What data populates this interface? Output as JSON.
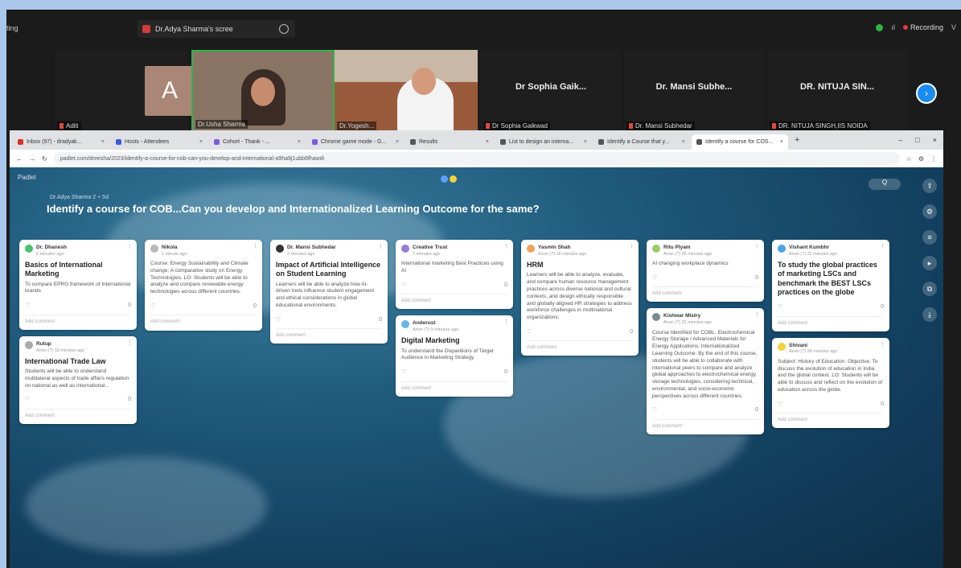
{
  "meeting": {
    "left_text": "ting",
    "share_label": "Dr.Adya Sharma's scree",
    "recording": "Recording"
  },
  "participants": [
    {
      "name": "Aditi",
      "initial": "A"
    },
    {
      "name": "Dr.Usha Sharma"
    },
    {
      "name": "Dr.Yogesh..."
    },
    {
      "name": "Dr Sophia Gaikwad",
      "big": "Dr Sophia Gaik..."
    },
    {
      "name": "Dr. Mansi Subhedar",
      "big": "Dr. Mansi Subhe..."
    },
    {
      "name": "DR. NITUJA SINGH,IIS NOIDA",
      "big": "DR. NITUJA SIN..."
    }
  ],
  "browser": {
    "tabs": [
      {
        "label": "Inbox (97) - dradyak..."
      },
      {
        "label": "Hosts - Attendees"
      },
      {
        "label": "Cohort - Thank - ..."
      },
      {
        "label": "Chrome game mode - G..."
      },
      {
        "label": "Results"
      },
      {
        "label": "List to design an interna..."
      },
      {
        "label": "Identify a Course that y..."
      },
      {
        "label": "Identify a course for COS...",
        "active": true
      }
    ],
    "url": "padlet.com/dreesha/2023/identify-a-course-for-cob-can-you-develop-and-international-a9ha9j1ubb6fhawdi"
  },
  "padlet": {
    "brand": "Padlet",
    "author": "Dr.Adya Sharma 2 + 5d",
    "title": "Identify a course for COB...Can you develop and Internationalized Learning Outcome for the same?",
    "search": "Q",
    "logo_colors": [
      "#5aa1ff",
      "#f2d33a"
    ],
    "columns": [
      [
        {
          "who": "Dr. Dhanesh",
          "when": "5 minutes ago",
          "avatar": "#49c26d",
          "title": "Basics of International Marketing",
          "body": "To compare EPRG framework of International brands",
          "likes": "0",
          "comment": "Add comment"
        },
        {
          "who": "Rutup",
          "when": "Anon (?) 18 minutes ago",
          "avatar": "#aaa",
          "title": "International Trade Law",
          "body": "Students will be able to understand multilateral aspects of trade affairs regulation on national as well as international...",
          "likes": "0",
          "comment": "Add comment"
        }
      ],
      [
        {
          "who": "Nikola",
          "when": "1 minute ago",
          "avatar": "#b8b8b8",
          "title": "",
          "body": "Course: Energy Sustainability and Climate change; A comparative study on Energy Technologies. LO: Students will be able to analyze and compare renewable energy technologies across different countries.",
          "likes": "0",
          "comment": "Add comment"
        }
      ],
      [
        {
          "who": "Dr. Mansi Subhedar",
          "when": "2 minutes ago",
          "avatar": "#333",
          "title": "Impact of Artificial Intelligence on Student Learning",
          "body": "Learners will be able to analyze how AI-driven tools influence student engagement and ethical considerations in global educational environments.",
          "likes": "0",
          "comment": "Add comment"
        }
      ],
      [
        {
          "who": "Creative Trust",
          "when": "7 minutes ago",
          "avatar": "#9a7bd9",
          "title": "",
          "body": "International marketing Best Practices using AI",
          "likes": "0",
          "comment": "Add comment"
        },
        {
          "who": "Anderust",
          "when": "Anon (?) 9 minutes ago",
          "avatar": "#6ab4e6",
          "title": "Digital Marketing",
          "body": "To understand the Disparitions of Target Audience in Marketing Strategy",
          "likes": "0",
          "comment": "Add comment"
        }
      ],
      [
        {
          "who": "Yasmin Shah",
          "when": "Anon (?) 16 minutes ago",
          "avatar": "#f0a35a",
          "title": "HRM",
          "body": "Learners will be able to analyze, evaluate, and compare human resource management practices across diverse national and cultural contexts, and design ethically responsible and globally aligned HR strategies to address workforce challenges in multinational organizations.",
          "likes": "0",
          "comment": "Add comment"
        }
      ],
      [
        {
          "who": "Ritu Plyam",
          "when": "Anon (?) 26 minutes ago",
          "avatar": "#9ccc65",
          "title": "",
          "body": "AI changing workplace dynamics",
          "likes": "0",
          "comment": "Add comment"
        },
        {
          "who": "Kishwar Mistry",
          "when": "Anon (?) 32 minutes ago",
          "avatar": "#7a8b8e",
          "title": "",
          "body": "Course Identified for COBL: Electrochemical Energy Storage / Advanced Materials for Energy Applications. Internationalized Learning Outcome: By the end of this course, students will be able to collaborate with international peers to compare and analyze global approaches to electrochemical energy storage technologies, considering technical, environmental, and socio-economic perspectives across different countries.",
          "likes": "0",
          "comment": "Add comment"
        }
      ],
      [
        {
          "who": "Vishant Kumbhr",
          "when": "Anon (?) 31 minutes ago",
          "avatar": "#4aa3e8",
          "title": "To study the global practices of marketing LSCs and benchmark the BEST LSCs practices on the globe",
          "body": "",
          "likes": "0",
          "comment": "Add comment"
        },
        {
          "who": "Shivani",
          "when": "Anon (?) 34 minutes ago",
          "avatar": "#f2d33a",
          "title": "",
          "body": "Subject: History of Education. Objective: To discuss the evolution of education in India and the global context. LO: Students will be able to discuss and reflect on the evolution of education across the globe.",
          "likes": "0",
          "comment": "Add comment"
        }
      ]
    ]
  }
}
